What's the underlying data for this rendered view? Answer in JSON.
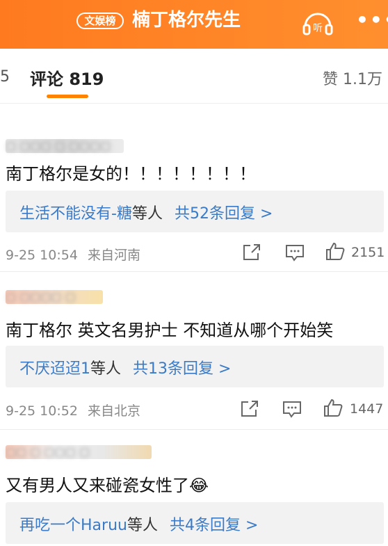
{
  "header": {
    "badge": "文娱榜",
    "title": "楠丁格尔先生",
    "listen_label": "听",
    "more": "•••",
    "colors": {
      "primary": "#ff7a1f",
      "text": "#ffffff"
    }
  },
  "tabs": {
    "prev_fragment": "5",
    "comments_label": "评论 819",
    "likes_label": "赞 1.1万"
  },
  "comments": [
    {
      "username": "▢ ▢▢▢ ▢ ▢▢▢▢",
      "text": "南丁格尔是女的！！！！！！！！",
      "reply_user": "生活不能没有-糖",
      "reply_mid": "等人",
      "reply_count": "共52条回复 >",
      "time": "9-25 10:54",
      "location": "来自河南",
      "likes": "2151"
    },
    {
      "username": "▢ ▢▢▢▢ ▢",
      "text": "南丁格尔 英文名男护士 不知道从哪个开始笑",
      "reply_user": "不厌迢迢1",
      "reply_mid": "等人",
      "reply_count": "共13条回复 >",
      "time": "9-25 10:52",
      "location": "来自北京",
      "likes": "1447"
    },
    {
      "username": "▢▢ ▢ ▢▢▢ ▢",
      "text": "又有男人又来碰瓷女性了😂",
      "reply_user": "再吃一个Haruu",
      "reply_mid": "等人",
      "reply_count": "共4条回复 >",
      "time": "",
      "location": "",
      "likes": ""
    }
  ]
}
